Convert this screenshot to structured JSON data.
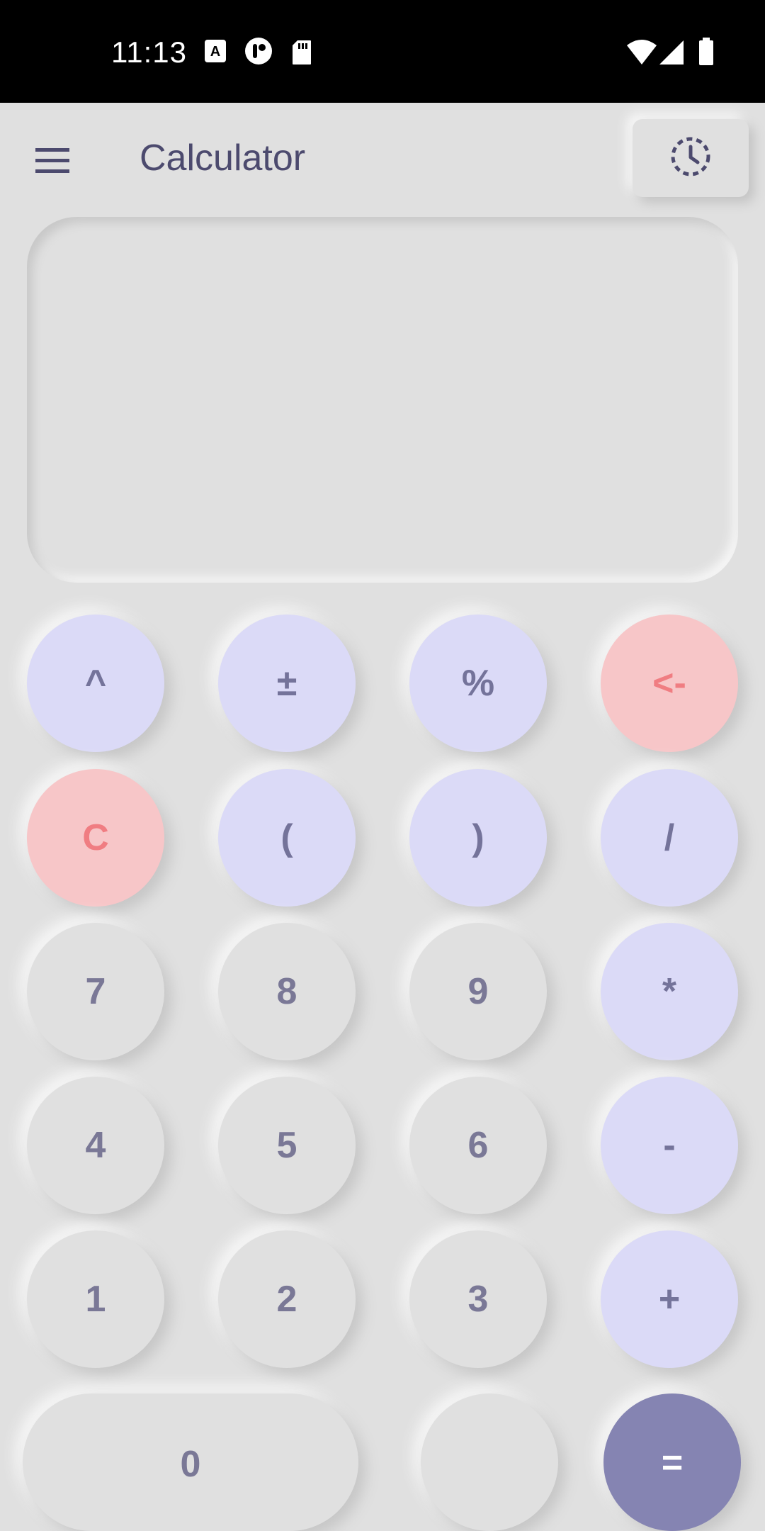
{
  "status_bar": {
    "time": "11:13"
  },
  "header": {
    "title": "Calculator",
    "menu_icon": "hamburger-menu-icon",
    "history_icon": "history-clock-icon"
  },
  "display": {
    "value": ""
  },
  "keypad": {
    "row1": [
      "^",
      "±",
      "%",
      "<-"
    ],
    "row2": [
      "C",
      "(",
      ")",
      "/"
    ],
    "row3": [
      "7",
      "8",
      "9",
      "*"
    ],
    "row4": [
      "4",
      "5",
      "6",
      "-"
    ],
    "row5": [
      "1",
      "2",
      "3",
      "+"
    ],
    "row6": [
      "0",
      "",
      "="
    ]
  },
  "colors": {
    "background": "#e0e0e0",
    "operator": "#dbdaf7",
    "danger": "#f7c6c8",
    "danger_text": "#f07d82",
    "equals": "#8584b2",
    "title": "#4c4a6e"
  }
}
